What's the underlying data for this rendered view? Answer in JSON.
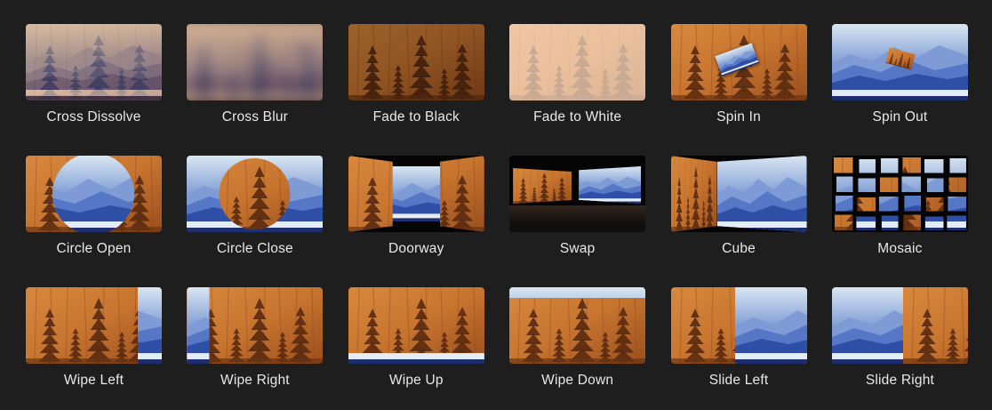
{
  "transitions": [
    {
      "id": "cross-dissolve",
      "label": "Cross Dissolve"
    },
    {
      "id": "cross-blur",
      "label": "Cross Blur"
    },
    {
      "id": "fade-to-black",
      "label": "Fade to Black"
    },
    {
      "id": "fade-to-white",
      "label": "Fade to White"
    },
    {
      "id": "spin-in",
      "label": "Spin In"
    },
    {
      "id": "spin-out",
      "label": "Spin Out"
    },
    {
      "id": "circle-open",
      "label": "Circle Open"
    },
    {
      "id": "circle-close",
      "label": "Circle Close"
    },
    {
      "id": "doorway",
      "label": "Doorway"
    },
    {
      "id": "swap",
      "label": "Swap"
    },
    {
      "id": "cube",
      "label": "Cube"
    },
    {
      "id": "mosaic",
      "label": "Mosaic"
    },
    {
      "id": "wipe-left",
      "label": "Wipe Left"
    },
    {
      "id": "wipe-right",
      "label": "Wipe Right"
    },
    {
      "id": "wipe-up",
      "label": "Wipe Up"
    },
    {
      "id": "wipe-down",
      "label": "Wipe Down"
    },
    {
      "id": "slide-left",
      "label": "Slide Left"
    },
    {
      "id": "slide-right",
      "label": "Slide Right"
    }
  ],
  "colors": {
    "background": "#1e1e1e",
    "label": "#e8e8e8",
    "forest_orange": "#c7742f",
    "forest_dark": "#5a2a10",
    "mountain_blue": "#3d62b8"
  }
}
